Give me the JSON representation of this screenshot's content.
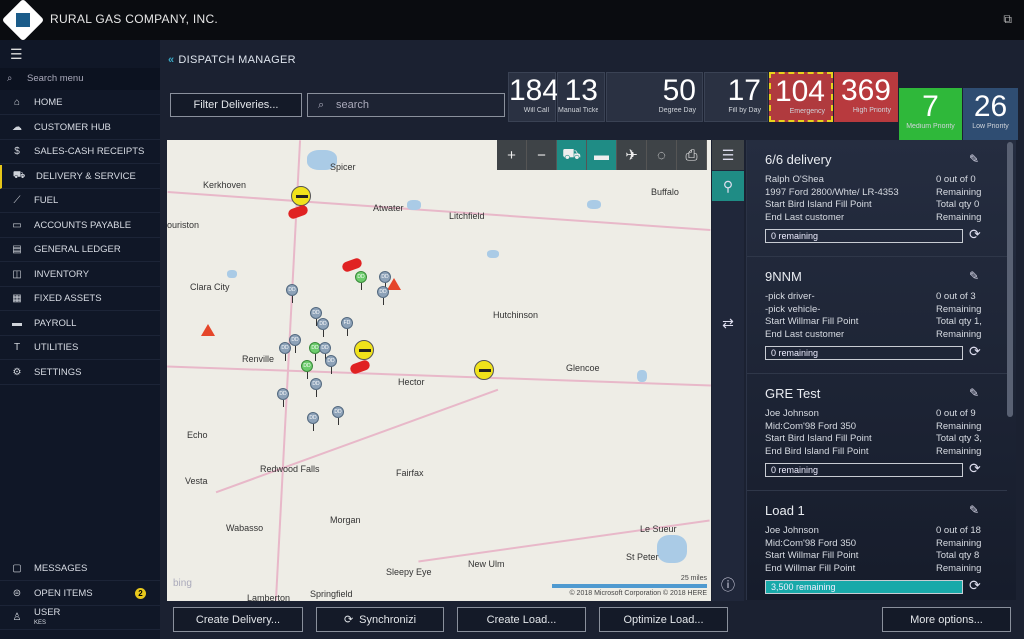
{
  "app": {
    "company": "RURAL GAS COMPANY, INC.",
    "popout_icon": "popout-icon"
  },
  "sidebar": {
    "search_placeholder": "Search menu",
    "items": [
      {
        "label": "HOME",
        "icon": "⌂"
      },
      {
        "label": "CUSTOMER HUB",
        "icon": "☁"
      },
      {
        "label": "SALES-CASH RECEIPTS",
        "icon": "$"
      },
      {
        "label": "DELIVERY & SERVICE",
        "icon": "⛟",
        "active": true
      },
      {
        "label": "FUEL",
        "icon": "⟋"
      },
      {
        "label": "ACCOUNTS PAYABLE",
        "icon": "▭"
      },
      {
        "label": "GENERAL LEDGER",
        "icon": "▤"
      },
      {
        "label": "INVENTORY",
        "icon": "◫"
      },
      {
        "label": "FIXED ASSETS",
        "icon": "▦"
      },
      {
        "label": "PAYROLL",
        "icon": "▬"
      },
      {
        "label": "UTILITIES",
        "icon": "T"
      },
      {
        "label": "SETTINGS",
        "icon": "⚙"
      }
    ],
    "bottom": [
      {
        "label": "MESSAGES",
        "icon": "▢"
      },
      {
        "label": "OPEN ITEMS",
        "icon": "⊜",
        "badge": "2"
      },
      {
        "label": "USER",
        "sub": "KES",
        "icon": "♙"
      }
    ]
  },
  "header": {
    "title": "DISPATCH MANAGER",
    "filter_label": "Filter Deliveries...",
    "search_placeholder": "search"
  },
  "tiles": [
    {
      "value": "184",
      "label": "Will Call"
    },
    {
      "value": "13",
      "label": "Manual Ticket"
    },
    {
      "value": "50",
      "label": "Degree Day"
    },
    {
      "value": "17",
      "label": "Fill by Day"
    },
    {
      "value": "104",
      "label": "Emergency",
      "color": "#b03a3e"
    },
    {
      "value": "369",
      "label": "High Priority",
      "color": "#b83a3e"
    },
    {
      "value": "7",
      "label": "Medium Priority",
      "color": "#2fb83a"
    },
    {
      "value": "26",
      "label": "Low Priority",
      "color": "#2f4d72"
    }
  ],
  "map": {
    "towns": [
      "Spicer",
      "Kerkhoven",
      "Atwater",
      "Litchfield",
      "Buffalo",
      "ouriston",
      "Clara City",
      "Hutchinson",
      "Renville",
      "Hector",
      "Glencoe",
      "Echo",
      "Vesta",
      "Redwood Falls",
      "Fairfax",
      "Le Sueur",
      "Wabasso",
      "Morgan",
      "St Peter",
      "New Ulm",
      "Sleepy Eye",
      "Lamberton",
      "Springfield"
    ],
    "scale": "25 miles",
    "copyright": "© 2018 Microsoft Corporation  © 2018 HERE",
    "bing": "bing",
    "tools": [
      "+",
      "−",
      "⛟",
      "▬",
      "✈",
      "◌",
      "⎙"
    ]
  },
  "loads": [
    {
      "title": "6/6 delivery",
      "left": [
        "Ralph O'Shea",
        "1997 Ford 2800/Whte/ LR-4353",
        "Start Bird Island Fill Point",
        "End Last customer"
      ],
      "right": [
        "0 out of 0",
        "Remaining",
        "Total qty 0",
        "Remaining"
      ],
      "progress": "0 remaining",
      "fill": 0
    },
    {
      "title": "9NNM",
      "left": [
        "-pick driver-",
        "-pick vehicle-",
        "Start Willmar Fill Point",
        "End Last customer"
      ],
      "right": [
        "0 out of 3",
        "Remaining",
        "Total qty 1,",
        "Remaining"
      ],
      "progress": "0 remaining",
      "fill": 0
    },
    {
      "title": "GRE Test",
      "left": [
        "Joe Johnson",
        "Mid:Com'98 Ford 350",
        "Start Bird Island Fill Point",
        "End Bird Island Fill Point"
      ],
      "right": [
        "0 out of 9",
        "Remaining",
        "Total qty 3,",
        "Remaining"
      ],
      "progress": "0 remaining",
      "fill": 0
    },
    {
      "title": "Load 1",
      "left": [
        "Joe Johnson",
        "Mid:Com'98 Ford 350",
        "Start Willmar Fill Point",
        "End Willmar Fill Point"
      ],
      "right": [
        "0 out of 18",
        "Remaining",
        "Total qty 8",
        "Remaining"
      ],
      "progress": "3,500 remaining",
      "fill": 100
    }
  ],
  "actions": {
    "create_delivery": "Create Delivery...",
    "synchronize": "Synchronizi",
    "create_load": "Create Load...",
    "optimize_load": "Optimize Load...",
    "more_options": "More options..."
  }
}
